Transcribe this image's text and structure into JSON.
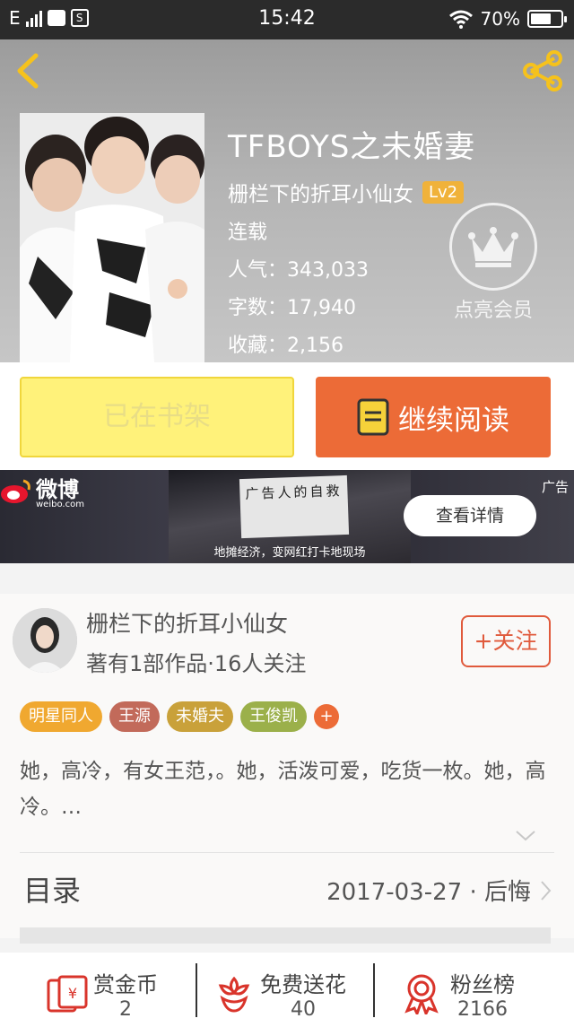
{
  "status_bar": {
    "network": "E",
    "time": "15:42",
    "battery": "70%",
    "battery_level": 0.7
  },
  "book": {
    "title": "TFBOYS之未婚妻",
    "author": "栅栏下的折耳小仙女",
    "level": "Lv2",
    "status": "连载",
    "popularity": "人气：343,033",
    "words": "字数：17,940",
    "collections": "收藏：2,156"
  },
  "vip": {
    "label": "点亮会员"
  },
  "actions": {
    "shelf_label": "已在书架",
    "read_label": "继续阅读"
  },
  "ad": {
    "logo_text": "微博",
    "logo_sub": "weibo.com",
    "caption": "地摊经济，变网红打卡地现场",
    "sign_text": "广告人的自救",
    "button_label": "查看详情",
    "tag": "广告"
  },
  "author_section": {
    "name": "栅栏下的折耳小仙女",
    "meta": "著有1部作品·16人关注",
    "follow_label": "+关注",
    "tags": [
      {
        "label": "明星同人",
        "color": "#f0a830"
      },
      {
        "label": "王源",
        "color": "#c26a5a"
      },
      {
        "label": "未婚夫",
        "color": "#c9a13a"
      },
      {
        "label": "王俊凯",
        "color": "#9bb04a"
      }
    ],
    "tag_more": "+",
    "tag_more_color": "#ec6b37",
    "description": "她，高冷，有女王范，。她，活泼可爱，吃货一枚。她，高冷。…",
    "toc_label": "目录",
    "toc_latest": "2017-03-27 · 后悔"
  },
  "bottom": {
    "reward": {
      "label": "赏金币",
      "count": "2"
    },
    "flower": {
      "label": "免费送花",
      "count": "40"
    },
    "fans": {
      "label": "粉丝榜",
      "count": "2166"
    }
  },
  "colors": {
    "accent": "#ec6b37",
    "gold": "#f0b23a",
    "icon_red": "#d9342b"
  }
}
